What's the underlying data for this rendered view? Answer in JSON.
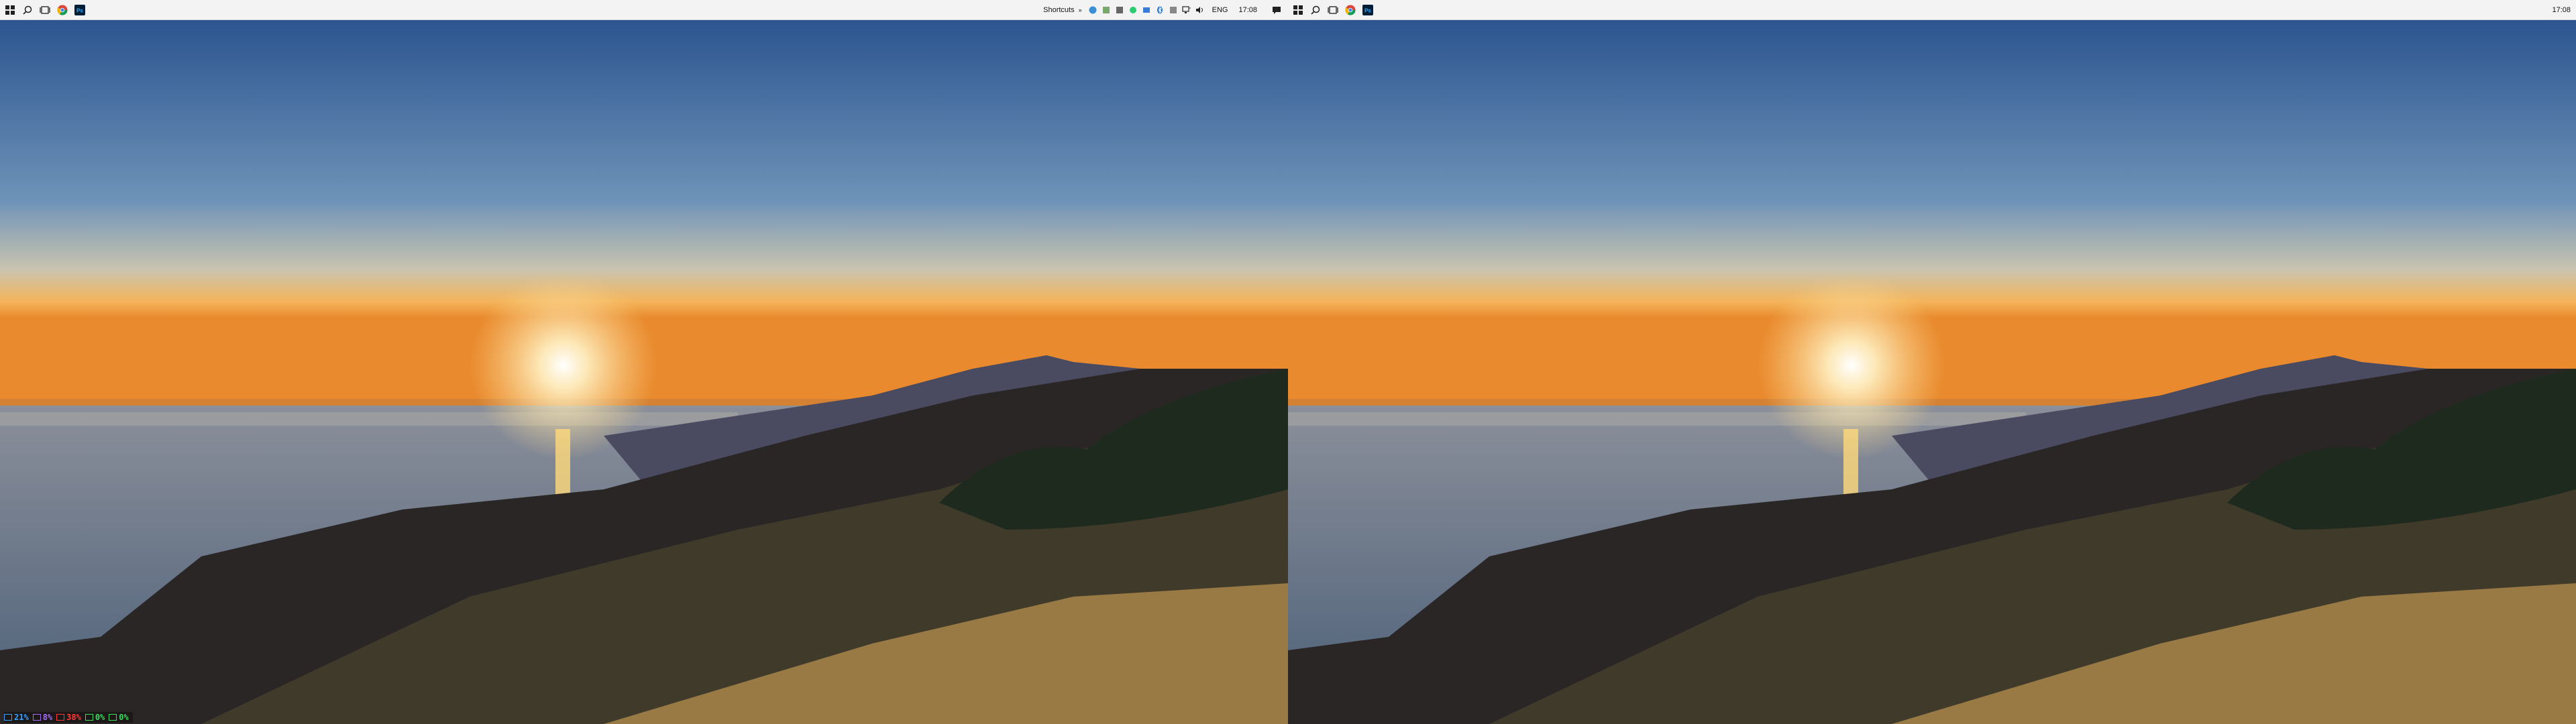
{
  "left_taskbar": {
    "shortcuts_label": "Shortcuts",
    "language": "ENG",
    "clock": "17:08"
  },
  "right_taskbar": {
    "clock": "17:08"
  },
  "hud": {
    "cpu": "21%",
    "mem": "8%",
    "disk": "38%",
    "net1": "0%",
    "net2": "0%",
    "cpu_color": "#3aa0ff",
    "mem_color": "#a56cff",
    "disk_color": "#ff3a3a",
    "net_color": "#3adf5a"
  },
  "icons": {
    "start": "windows-start-icon",
    "search": "search-icon",
    "task_view": "task-view-icon",
    "chrome": "chrome-icon",
    "photoshop": "photoshop-icon"
  },
  "wallpaper": {
    "sky_top": "#2c5d95",
    "sky_horizon": "#f1b55a",
    "sun": "#fff8d8"
  }
}
